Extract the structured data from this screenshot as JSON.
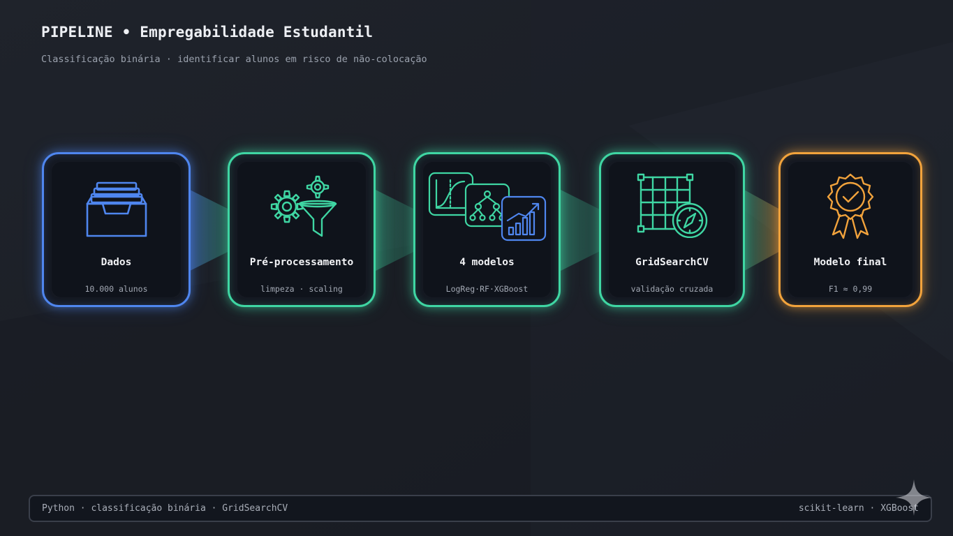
{
  "header": {
    "title": "PIPELINE • Empregabilidade Estudantil",
    "subtitle": "Classificação binária · identificar alunos em risco de não-colocação"
  },
  "stages": [
    {
      "label": "Dados",
      "detail": "10.000 alunos",
      "icon": "archive-tray-icon",
      "color": "#4f86ef"
    },
    {
      "label": "Pré-processamento",
      "detail": "limpeza · scaling",
      "icon": "gears-funnel-icon",
      "color": "#3fd6a3"
    },
    {
      "label": "4 modelos",
      "detail": "LogReg·RF·XGBoost",
      "icon": "model-charts-icon",
      "color": "#3fd6a3"
    },
    {
      "label": "GridSearchCV",
      "detail": "validação cruzada",
      "icon": "grid-compass-icon",
      "color": "#3fd6a3"
    },
    {
      "label": "Modelo final",
      "detail": "F1 ≈ 0,99",
      "icon": "award-badge-icon",
      "color": "#f2a33c"
    }
  ],
  "footer": {
    "left": "Python · classificação binária · GridSearchCV",
    "right": "scikit-learn · XGBoost"
  },
  "decor": {
    "corner_icon": "sparkle-icon"
  }
}
